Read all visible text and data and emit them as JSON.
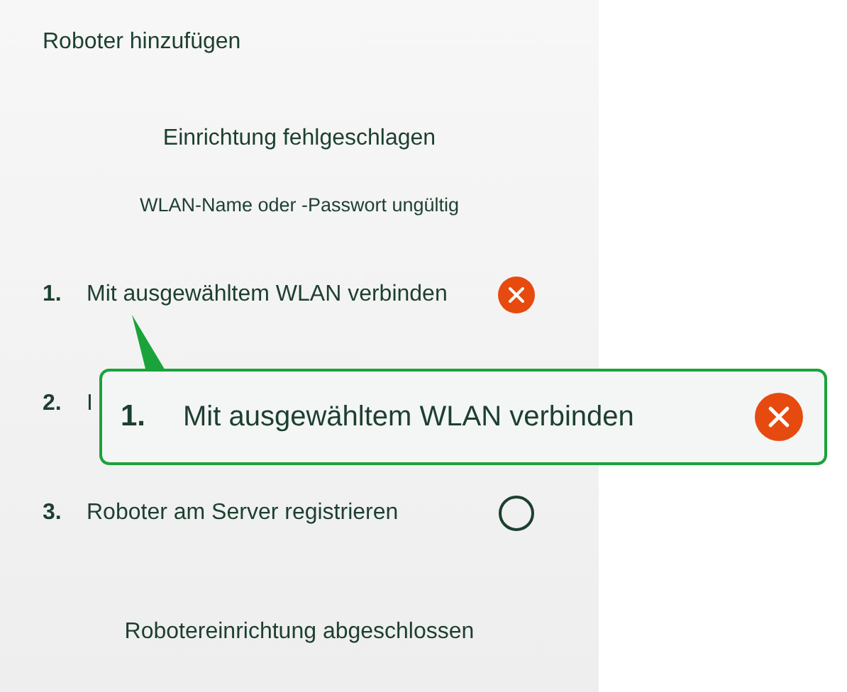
{
  "header": {
    "title": "Roboter hinzufügen"
  },
  "status": {
    "heading": "Einrichtung fehlgeschlagen",
    "message": "WLAN-Name oder -Passwort ungültig"
  },
  "steps": [
    {
      "number": "1.",
      "label": "Mit ausgewähltem WLAN verbinden",
      "failed": true
    },
    {
      "number": "2.",
      "label": "I"
    },
    {
      "number": "3.",
      "label": "Roboter am Server registrieren",
      "failed": false
    }
  ],
  "footer": {
    "text": "Robotereinrichtung abgeschlossen"
  },
  "callout": {
    "number": "1.",
    "label": "Mit ausgewähltem WLAN verbinden",
    "failed": true
  }
}
